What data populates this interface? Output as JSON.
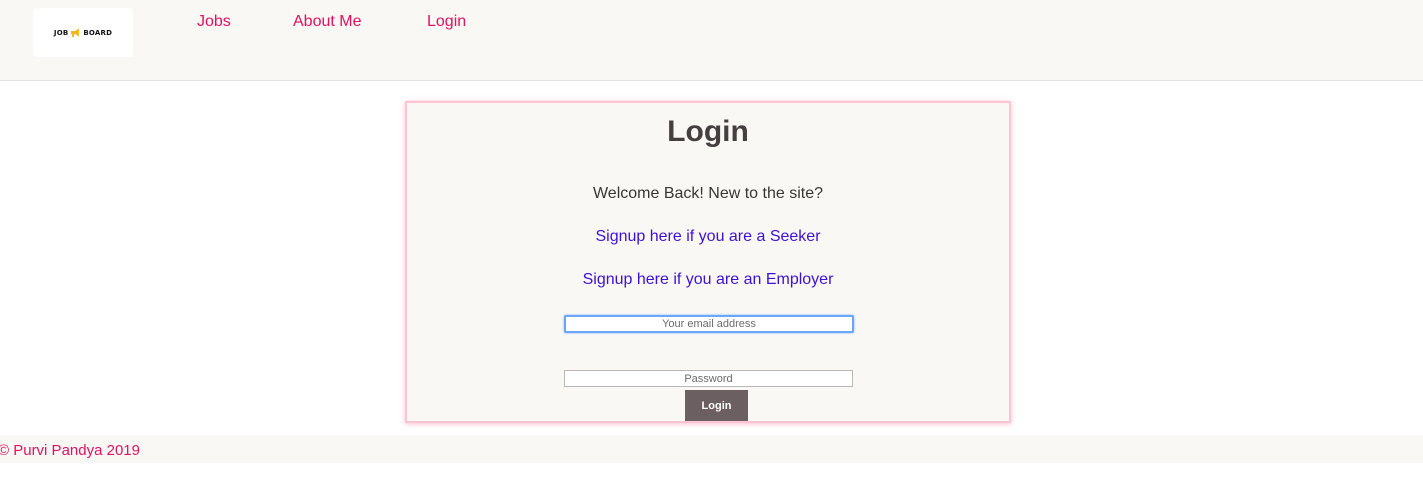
{
  "header": {
    "logo": {
      "text_left": "JOB",
      "text_right": "BOARD",
      "icon": "megaphone-icon"
    },
    "nav": {
      "jobs": "Jobs",
      "about": "About Me",
      "login": "Login"
    }
  },
  "login_card": {
    "title": "Login",
    "welcome": "Welcome Back! New to the site?",
    "signup_seeker": "Signup here if you are a Seeker",
    "signup_employer": "Signup here if you are an Employer",
    "email_placeholder": "Your email address",
    "password_placeholder": "Password",
    "submit_label": "Login"
  },
  "footer": {
    "copyright": "© Purvi Pandya 2019"
  },
  "colors": {
    "accent": "#e0115f",
    "link": "#3d11d6",
    "button": "#6b5f61",
    "card_border": "#fdc5d3",
    "background_panel": "#faf8f5"
  }
}
